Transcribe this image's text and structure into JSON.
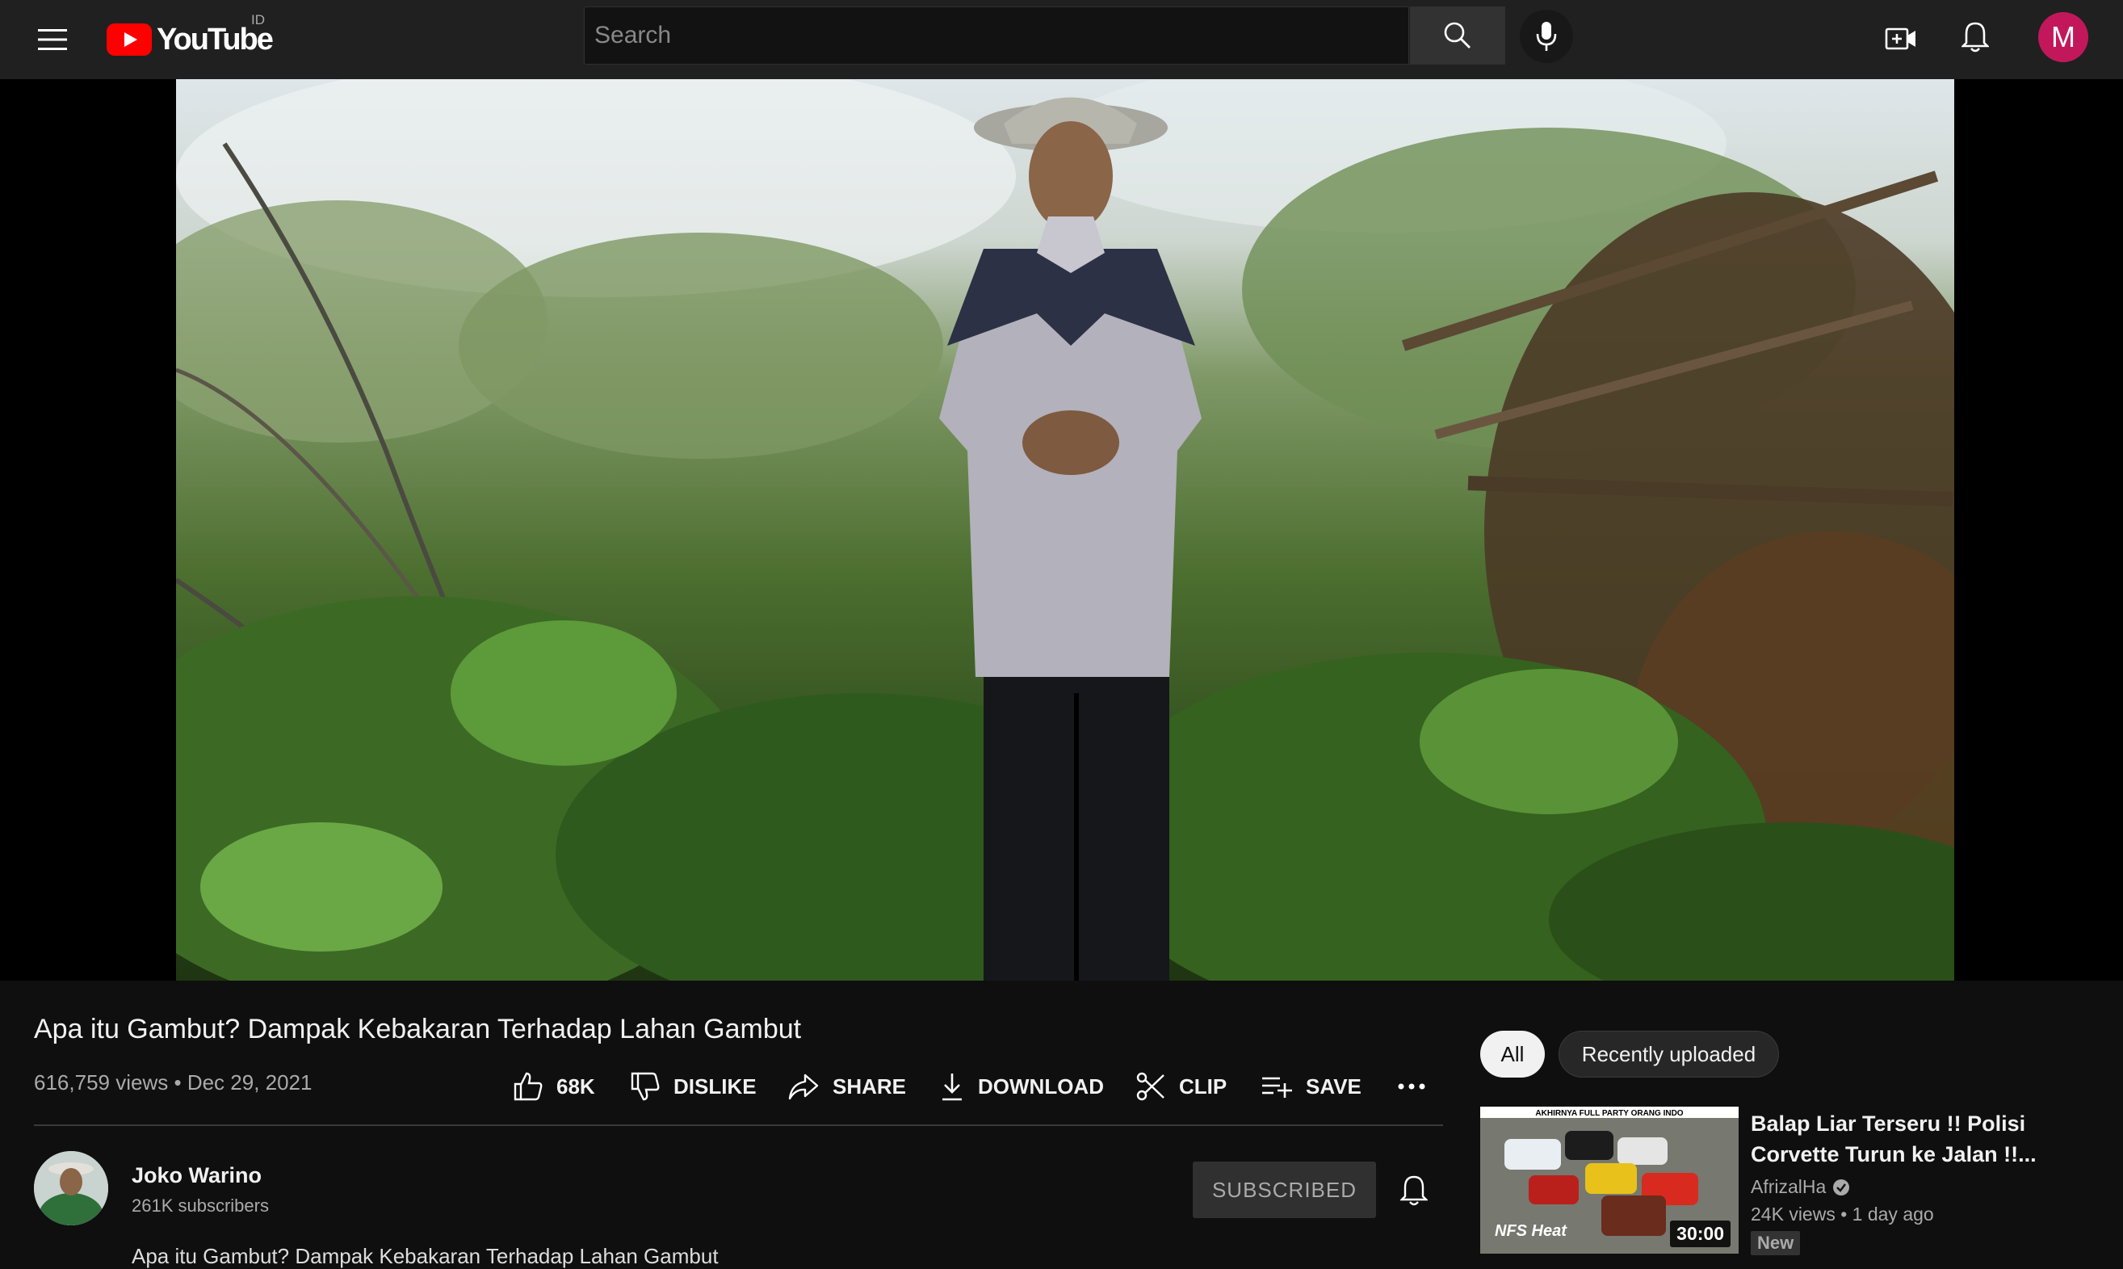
{
  "header": {
    "logo_text": "YouTube",
    "country_code": "ID",
    "search_placeholder": "Search",
    "avatar_letter": "M"
  },
  "video": {
    "title": "Apa itu Gambut? Dampak Kebakaran Terhadap Lahan Gambut",
    "views": "616,759 views",
    "date": "Dec 29, 2021",
    "meta_separator": "•"
  },
  "actions": {
    "like_count": "68K",
    "dislike_label": "DISLIKE",
    "share_label": "SHARE",
    "download_label": "DOWNLOAD",
    "clip_label": "CLIP",
    "save_label": "SAVE"
  },
  "channel": {
    "name": "Joko Warino",
    "subscribers": "261K subscribers",
    "subscribe_label": "SUBSCRIBED"
  },
  "description_peek": "Apa itu Gambut? Dampak Kebakaran Terhadap Lahan Gambut",
  "filters": {
    "chips": [
      "All",
      "Recently uploaded"
    ],
    "selected": "All"
  },
  "recommendations": [
    {
      "title": "Balap Liar Terseru !! Polisi Corvette Turun ke Jalan !!...",
      "channel": "AfrizalHa",
      "views": "24K views",
      "age": "1 day ago",
      "separator": "•",
      "badge": "New",
      "duration": "30:00",
      "thumb_banner": "AKHIRNYA FULL PARTY ORANG INDO",
      "thumb_logo": "NFS Heat"
    }
  ],
  "colors": {
    "background": "#0f0f0f",
    "topbar": "#202020",
    "youtube_red": "#ff0000",
    "avatar": "#c2185b"
  },
  "icons": [
    "menu-icon",
    "youtube-play-icon",
    "search-icon",
    "microphone-icon",
    "create-video-icon",
    "bell-icon",
    "thumbs-up-icon",
    "thumbs-down-icon",
    "share-arrow-icon",
    "download-icon",
    "scissors-icon",
    "playlist-add-icon",
    "more-horizontal-icon",
    "verified-check-icon"
  ]
}
